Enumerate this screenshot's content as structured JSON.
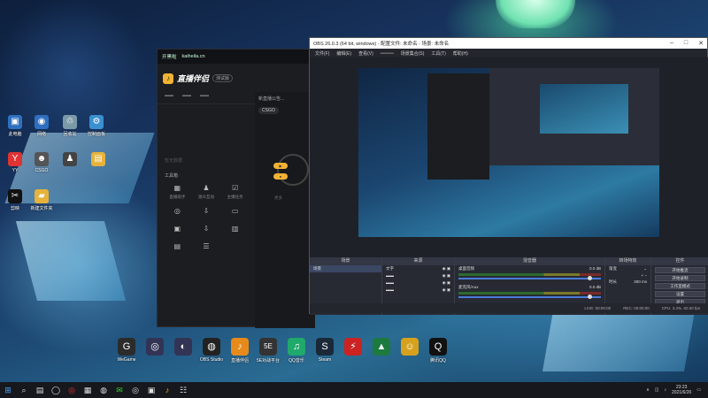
{
  "desktop": {
    "icons": [
      {
        "label": "此电脑",
        "glyph": "▣",
        "color": "#2f6fbf"
      },
      {
        "label": "网络",
        "glyph": "◉",
        "color": "#2f6fbf"
      },
      {
        "label": "回收站",
        "glyph": "♲",
        "color": "#8aa"
      },
      {
        "label": "控制面板",
        "glyph": "⚙",
        "color": "#3a8fd0"
      },
      {
        "label": "YY",
        "glyph": "Y",
        "color": "#d33"
      },
      {
        "label": "CSGO",
        "glyph": "☻",
        "color": "#555"
      },
      {
        "label": "",
        "glyph": "♟",
        "color": "#444"
      },
      {
        "label": "",
        "glyph": "▤",
        "color": "#e7b23a"
      },
      {
        "label": "剪映",
        "glyph": "✂",
        "color": "#111"
      },
      {
        "label": "新建文件夹",
        "glyph": "▰",
        "color": "#e7b23a"
      }
    ],
    "bottom_icons": [
      {
        "label": "WeGame",
        "glyph": "G",
        "color": "#2b2b2b"
      },
      {
        "label": "",
        "glyph": "◎",
        "color": "#335"
      },
      {
        "label": "",
        "glyph": "◐",
        "color": "#335"
      },
      {
        "label": "OBS Studio",
        "glyph": "◍",
        "color": "#222"
      },
      {
        "label": "直播伴侣",
        "glyph": "♪",
        "color": "#e88a1a"
      },
      {
        "label": "5E对战平台",
        "glyph": "5E",
        "color": "#333"
      },
      {
        "label": "QQ音乐",
        "glyph": "♫",
        "color": "#1fa96b"
      },
      {
        "label": "Steam",
        "glyph": "S",
        "color": "#1b2838"
      },
      {
        "label": "",
        "glyph": "⚡",
        "color": "#c22"
      },
      {
        "label": "",
        "glyph": "▲",
        "color": "#1d7a3e"
      },
      {
        "label": "",
        "glyph": "☺",
        "color": "#d6a21e"
      },
      {
        "label": "腾讯QQ",
        "glyph": "Q",
        "color": "#111"
      }
    ]
  },
  "companion": {
    "top_left": "开黑啦",
    "top_url": "kaiheila.cn",
    "brand": "直播伴侣",
    "version": "测试版",
    "tabs": [
      "..."
    ],
    "empty_hint": "暂无数据",
    "tools_title": "工具箱",
    "tools": [
      {
        "label": "直播助手",
        "icon": "▦"
      },
      {
        "label": "观众互动",
        "icon": "♟"
      },
      {
        "label": "主播任务",
        "icon": "☑"
      },
      {
        "label": "",
        "icon": "◎"
      },
      {
        "label": "",
        "icon": "⇩"
      },
      {
        "label": "",
        "icon": "▭"
      },
      {
        "label": "",
        "icon": "▣"
      },
      {
        "label": "",
        "icon": "⇩"
      },
      {
        "label": "",
        "icon": "▥"
      },
      {
        "label": "",
        "icon": "▤"
      },
      {
        "label": "",
        "icon": "☰"
      }
    ],
    "right_line": "新直播公告...",
    "game_chip": "CSGO",
    "side_hint": "更多"
  },
  "obs": {
    "title": "OBS 26.0.3 (64 bit, windows) - 配置文件: 未命名 - 场景: 未命名",
    "menu": [
      "文件(F)",
      "编辑(E)",
      "查看(V)",
      "",
      "场景集合(S)",
      "工具(T)",
      "帮助(H)"
    ],
    "docks": {
      "scenes": {
        "title": "场景",
        "items": [
          "场景"
        ]
      },
      "sources": {
        "title": "来源",
        "items": [
          "文字"
        ]
      },
      "mixer": {
        "title": "混音器",
        "channels": [
          {
            "name": "桌面音频",
            "db": "0.0 dB"
          },
          {
            "name": "麦克风/Aux",
            "db": "0.0 dB"
          }
        ]
      },
      "transitions": {
        "title": "转场特效",
        "type": "渐变",
        "duration_label": "时长",
        "duration": "300 ms"
      },
      "controls": {
        "title": "控件",
        "buttons": [
          "开始推流",
          "开始录制",
          "工作室模式",
          "设置",
          "退出"
        ]
      }
    },
    "status": [
      "LIVE: 00:00:00",
      "REC: 00:00:00",
      "CPU: 3.4%, 60.00 fps"
    ]
  },
  "taskbar": {
    "icons": [
      "⊞",
      "⌕",
      "▤",
      "◯",
      "◎",
      "▦",
      "◍",
      "✉",
      "◎",
      "▣",
      "♪",
      "☷"
    ],
    "time": "23:23",
    "date": "2021/6/20"
  }
}
